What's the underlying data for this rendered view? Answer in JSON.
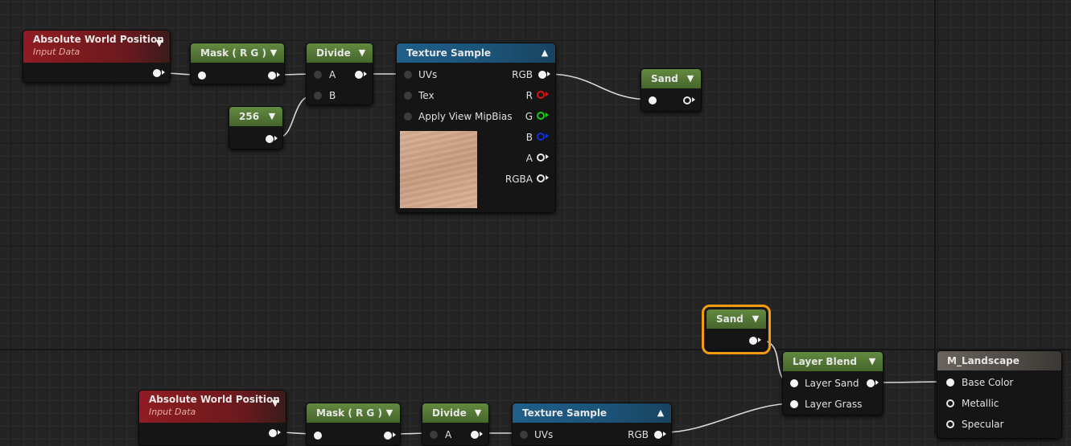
{
  "colors": {
    "wire": "#d8d8d8",
    "selection": "#f39c12",
    "function_header": "#8f1c22",
    "math_header": "#628a40",
    "texture_header": "#1f5f8a",
    "result_header": "#6a635d"
  },
  "top": {
    "abs_world": {
      "title": "Absolute World Position",
      "subtitle": "Input Data"
    },
    "mask": {
      "title": "Mask ( R G )"
    },
    "divide": {
      "title": "Divide",
      "pin_a": "A",
      "pin_b": "B"
    },
    "constant": {
      "value": "256"
    },
    "texture": {
      "title": "Texture Sample",
      "inputs": [
        "UVs",
        "Tex",
        "Apply View MipBias"
      ],
      "outputs": [
        "RGB",
        "R",
        "G",
        "B",
        "A",
        "RGBA"
      ]
    },
    "sand": {
      "title": "Sand"
    }
  },
  "bottom": {
    "sand": {
      "title": "Sand"
    },
    "layer_blend": {
      "title": "Layer Blend",
      "inputs": [
        "Layer Sand",
        "Layer Grass"
      ]
    },
    "material": {
      "title": "M_Landscape",
      "inputs": [
        "Base Color",
        "Metallic",
        "Specular"
      ]
    },
    "abs_world": {
      "title": "Absolute World Position",
      "subtitle": "Input Data"
    },
    "mask": {
      "title": "Mask ( R G )"
    },
    "divide": {
      "title": "Divide",
      "pin_a": "A"
    },
    "texture": {
      "title": "Texture Sample",
      "input_uvs": "UVs",
      "output_rgb": "RGB"
    }
  },
  "icons": {
    "collapse": "chevron-down-icon",
    "expand": "chevron-up-icon"
  }
}
